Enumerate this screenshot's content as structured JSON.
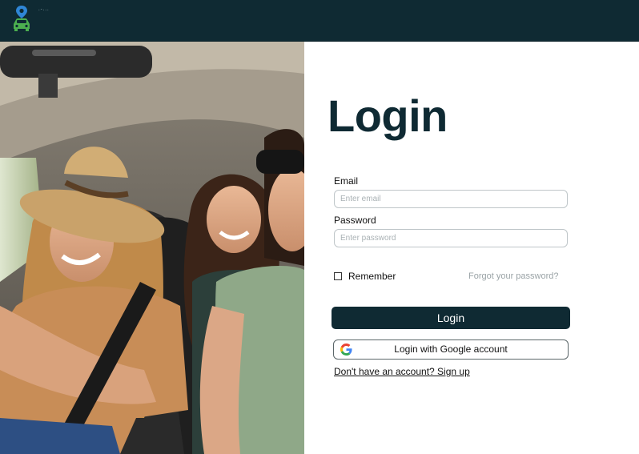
{
  "header": {
    "logo_icon": "car-location-pin-icon",
    "logo_text": ".-..."
  },
  "hero_image": {
    "icon": "photo-friends-in-car"
  },
  "login": {
    "title": "Login",
    "email_label": "Email",
    "email_placeholder": "Enter email",
    "email_value": "",
    "password_label": "Password",
    "password_placeholder": "Enter password",
    "password_value": "",
    "remember_label": "Remember",
    "remember_checked": false,
    "forgot_label": "Forgot your password?",
    "submit_label": "Login",
    "google_label": "Login with Google account",
    "signup_label": "Don't have an account? Sign up"
  },
  "colors": {
    "brand_dark": "#0f2a33",
    "pin_blue": "#2f86d6",
    "car_green": "#4caf50"
  }
}
